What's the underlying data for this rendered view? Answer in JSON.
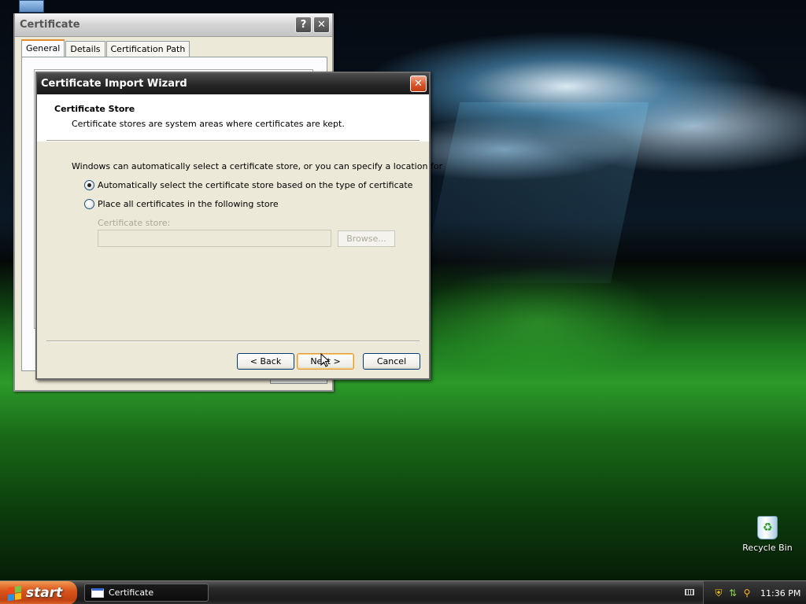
{
  "desktop": {
    "icons": {
      "my_computer_partial": "M",
      "recycle_bin": "Recycle Bin"
    }
  },
  "cert_window": {
    "title": "Certificate",
    "help": "?",
    "close": "✕",
    "tabs": [
      "General",
      "Details",
      "Certification Path"
    ],
    "active_tab": "General"
  },
  "wizard": {
    "title": "Certificate Import Wizard",
    "close": "✕",
    "header_title": "Certificate Store",
    "header_subtitle": "Certificate stores are system areas where certificates are kept.",
    "intro": "Windows can automatically select a certificate store, or you can specify a location for",
    "option_auto": "Automatically select the certificate store based on the type of certificate",
    "option_place": "Place all certificates in the following store",
    "selected_option": "auto",
    "store_label": "Certificate store:",
    "store_value": "",
    "browse": "Browse...",
    "back": "< Back",
    "next": "Next >",
    "cancel": "Cancel"
  },
  "taskbar": {
    "start": "start",
    "task_button": "Certificate",
    "clock": "11:36 PM"
  },
  "colors": {
    "taskbar": "#1b1b1b",
    "start": "#d8551c",
    "wizard_title": "#262626",
    "window_body": "#ece9d8",
    "default_button_border": "#e69b3a"
  }
}
